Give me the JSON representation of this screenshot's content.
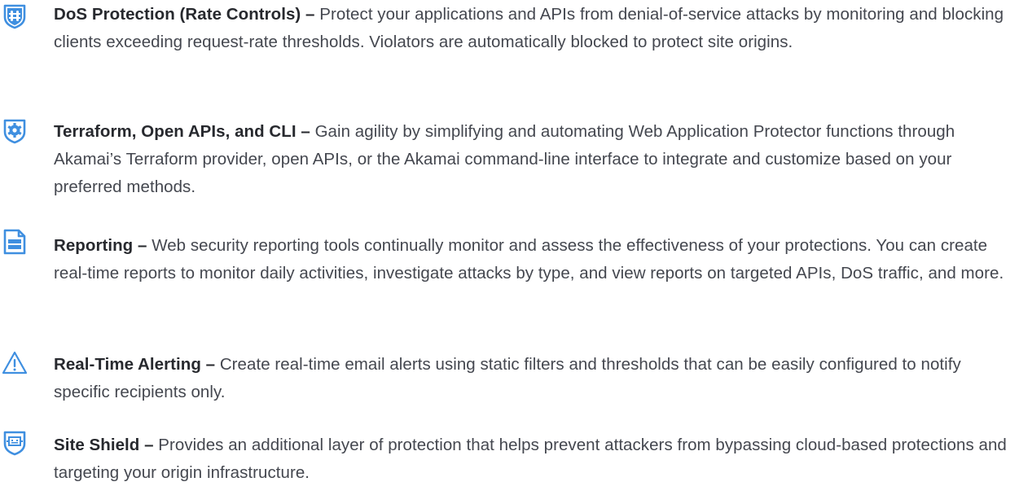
{
  "colors": {
    "icon_accent": "#3f8fe0",
    "title": "#27292e",
    "body": "#44474f"
  },
  "features": [
    {
      "icon": "bug-shield-icon",
      "title": "DoS Protection (Rate Controls) –",
      "description": "Protect your applications and APIs from denial-of-service attacks by monitoring and blocking clients exceeding request-rate thresholds. Violators are automatically blocked to protect site origins."
    },
    {
      "icon": "gear-shield-icon",
      "title": "Terraform, Open APIs, and CLI –",
      "description": "Gain agility by simplifying and automating Web Application Protector functions through Akamai’s Terraform provider, open APIs, or the Akamai command-line interface to integrate and customize based on your preferred methods."
    },
    {
      "icon": "report-document-icon",
      "title": "Reporting –",
      "description": "Web security reporting tools continually monitor and assess the effectiveness of your protections. You can create real-time reports to monitor daily activities, investigate attacks by type, and view reports on targeted APIs, DoS traffic, and more."
    },
    {
      "icon": "warning-triangle-icon",
      "title": "Real-Time Alerting –",
      "description": "Create real-time email alerts using static filters and thresholds that can be easily configured to notify specific recipients only."
    },
    {
      "icon": "server-shield-icon",
      "title": "Site Shield –",
      "description": "Provides an additional layer of protection that helps prevent attackers from bypassing cloud-based protections and targeting your origin infrastructure."
    }
  ]
}
